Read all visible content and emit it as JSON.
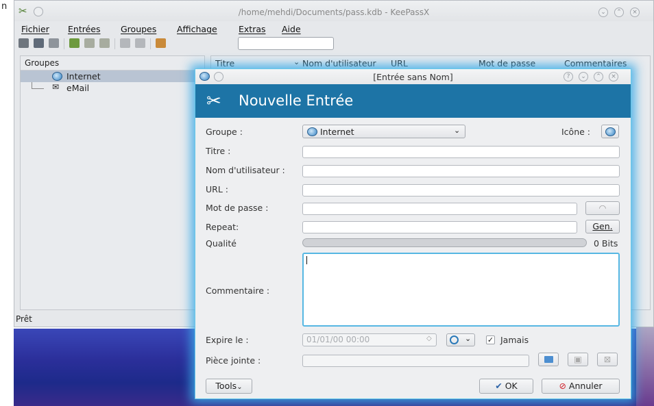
{
  "main": {
    "title": "/home/mehdi/Documents/pass.kdb - KeePassX",
    "menu": [
      "Fichier",
      "Entrées",
      "Groupes",
      "Affichage",
      "Extras",
      "Aide"
    ],
    "groups_header": "Groupes",
    "groups": [
      "Internet",
      "eMail"
    ],
    "columns": [
      "Titre",
      "Nom d'utilisateur",
      "URL",
      "Mot de passe",
      "Commentaires"
    ],
    "status": "Prêt",
    "title_partial": "n"
  },
  "dialog": {
    "title": "[Entrée sans Nom]",
    "banner": "Nouvelle Entrée",
    "labels": {
      "group": "Groupe :",
      "icon": "Icône :",
      "title": "Titre :",
      "username": "Nom d'utilisateur :",
      "url": "URL :",
      "password": "Mot de passe :",
      "repeat": "Repeat:",
      "quality": "Qualité",
      "comment": "Commentaire :",
      "expires": "Expire le :",
      "attachment": "Pièce jointe :"
    },
    "group_value": "Internet",
    "title_value": "",
    "username_value": "",
    "url_value": "",
    "password_value": "",
    "repeat_value": "",
    "quality_text": "0 Bits",
    "quality_fraction": 0,
    "comment_value": "",
    "expires_value": "01/01/00 00:00",
    "never_label": "Jamais",
    "never_checked": true,
    "gen_button": "Gen.",
    "tools_button": "Tools",
    "ok_button": "OK",
    "cancel_button": "Annuler"
  },
  "colors": {
    "banner": "#1d74a6",
    "focus_glow": "#56b7e3",
    "cancel_icon": "#d0202a"
  }
}
